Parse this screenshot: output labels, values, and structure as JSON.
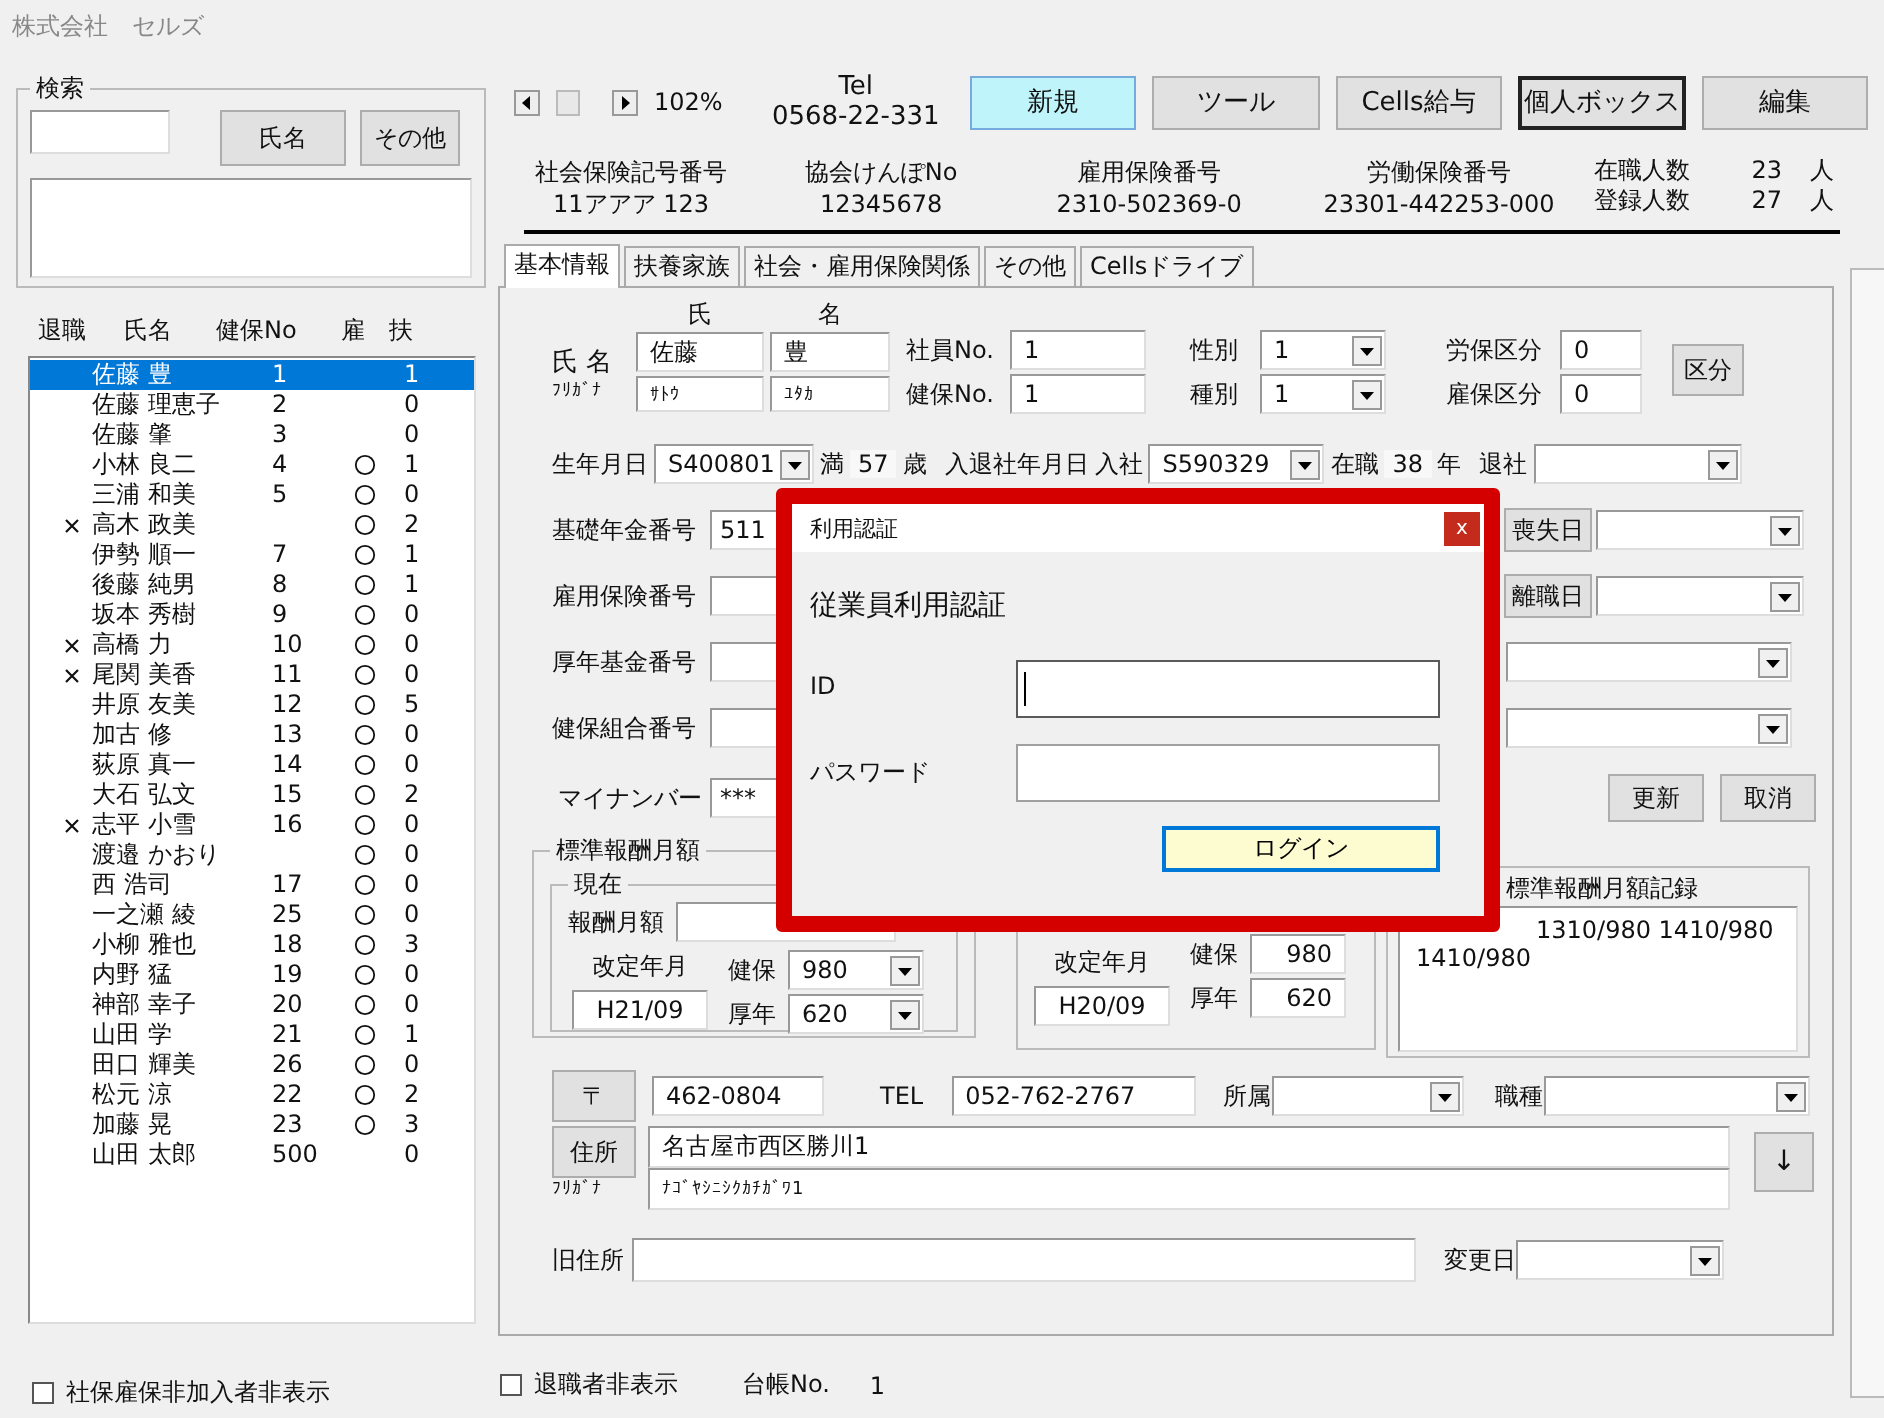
{
  "app_title": "株式会社　セルズ",
  "search": {
    "title": "検索",
    "buttons": [
      "氏名",
      "その他"
    ]
  },
  "employee_list": {
    "columns": [
      "退職",
      "氏名",
      "健保No",
      "雇",
      "扶"
    ],
    "rows": [
      {
        "retired": false,
        "name": "佐藤 豊",
        "kenpo_no": "1",
        "insured": false,
        "dependents": "1",
        "selected": true
      },
      {
        "retired": false,
        "name": "佐藤 理恵子",
        "kenpo_no": "2",
        "insured": false,
        "dependents": "0",
        "selected": false
      },
      {
        "retired": false,
        "name": "佐藤 肇",
        "kenpo_no": "3",
        "insured": false,
        "dependents": "0",
        "selected": false
      },
      {
        "retired": false,
        "name": "小林 良二",
        "kenpo_no": "4",
        "insured": true,
        "dependents": "1",
        "selected": false
      },
      {
        "retired": false,
        "name": "三浦 和美",
        "kenpo_no": "5",
        "insured": true,
        "dependents": "0",
        "selected": false
      },
      {
        "retired": true,
        "name": "高木 政美",
        "insured": true,
        "dependents": "2",
        "selected": false
      },
      {
        "retired": false,
        "name": "伊勢 順一",
        "kenpo_no": "7",
        "insured": true,
        "dependents": "1",
        "selected": false
      },
      {
        "retired": false,
        "name": "後藤 純男",
        "kenpo_no": "8",
        "insured": true,
        "dependents": "1",
        "selected": false
      },
      {
        "retired": false,
        "name": "坂本 秀樹",
        "kenpo_no": "9",
        "insured": true,
        "dependents": "0",
        "selected": false
      },
      {
        "retired": true,
        "name": "高橋 力",
        "kenpo_no": "10",
        "insured": true,
        "dependents": "0",
        "selected": false
      },
      {
        "retired": true,
        "name": "尾関 美香",
        "kenpo_no": "11",
        "insured": true,
        "dependents": "0",
        "selected": false
      },
      {
        "retired": false,
        "name": "井原 友美",
        "kenpo_no": "12",
        "insured": true,
        "dependents": "5",
        "selected": false
      },
      {
        "retired": false,
        "name": "加古 修",
        "kenpo_no": "13",
        "insured": true,
        "dependents": "0",
        "selected": false
      },
      {
        "retired": false,
        "name": "荻原 真一",
        "kenpo_no": "14",
        "insured": true,
        "dependents": "0",
        "selected": false
      },
      {
        "retired": false,
        "name": "大石 弘文",
        "kenpo_no": "15",
        "insured": true,
        "dependents": "2",
        "selected": false
      },
      {
        "retired": true,
        "name": "志平 小雪",
        "kenpo_no": "16",
        "insured": true,
        "dependents": "0",
        "selected": false
      },
      {
        "retired": false,
        "name": "渡邉 かおり",
        "insured": true,
        "dependents": "0",
        "selected": false
      },
      {
        "retired": false,
        "name": "西 浩司",
        "kenpo_no": "17",
        "insured": true,
        "dependents": "0",
        "selected": false
      },
      {
        "retired": false,
        "name": "一之瀬 綾",
        "kenpo_no": "25",
        "insured": true,
        "dependents": "0",
        "selected": false
      },
      {
        "retired": false,
        "name": "小柳 雅也",
        "kenpo_no": "18",
        "insured": true,
        "dependents": "3",
        "selected": false
      },
      {
        "retired": false,
        "name": "内野 猛",
        "kenpo_no": "19",
        "insured": true,
        "dependents": "0",
        "selected": false
      },
      {
        "retired": false,
        "name": "神部 幸子",
        "kenpo_no": "20",
        "insured": true,
        "dependents": "0",
        "selected": false
      },
      {
        "retired": false,
        "name": "山田 学",
        "kenpo_no": "21",
        "insured": true,
        "dependents": "1",
        "selected": false
      },
      {
        "retired": false,
        "name": "田口 輝美",
        "kenpo_no": "26",
        "insured": true,
        "dependents": "0",
        "selected": false
      },
      {
        "retired": false,
        "name": "松元 涼",
        "kenpo_no": "22",
        "insured": true,
        "dependents": "2",
        "selected": false
      },
      {
        "retired": false,
        "name": "加藤 晃",
        "kenpo_no": "23",
        "insured": true,
        "dependents": "3",
        "selected": false
      },
      {
        "retired": false,
        "name": "山田 太郎",
        "kenpo_no": "500",
        "insured": false,
        "dependents": "0",
        "selected": false
      }
    ]
  },
  "hide_uninsured": {
    "label": "社保雇保非加入者非表示",
    "checked": false
  },
  "zoom": {
    "value": "102%"
  },
  "tel": {
    "label": "Tel",
    "value": "0568-22-331"
  },
  "toolbar": [
    {
      "label": "新規",
      "highlighted": true,
      "focused": false
    },
    {
      "label": "ツール",
      "highlighted": false,
      "focused": false
    },
    {
      "label": "Cells給与",
      "highlighted": false,
      "focused": false
    },
    {
      "label": "個人ボックス",
      "highlighted": false,
      "focused": true
    },
    {
      "label": "編集",
      "highlighted": false,
      "focused": false
    }
  ],
  "insurance_numbers": [
    {
      "label": "社会保険記号番号",
      "value": "11アアア 123"
    },
    {
      "label": "協会けんぽNo",
      "value": "12345678"
    },
    {
      "label": "雇用保険番号",
      "value": "2310-502369-0"
    },
    {
      "label": "労働保険番号",
      "value": "23301-442253-000"
    }
  ],
  "headcounts": [
    {
      "label": "在職人数",
      "value": "23",
      "unit": "人"
    },
    {
      "label": "登録人数",
      "value": "27",
      "unit": "人"
    }
  ],
  "tabs": [
    {
      "label": "基本情報",
      "selected": true
    },
    {
      "label": "扶養家族",
      "selected": false
    },
    {
      "label": "社会・雇用保険関係",
      "selected": false
    },
    {
      "label": "その他",
      "selected": false
    },
    {
      "label": "Cellsドライブ",
      "selected": false
    }
  ],
  "basic_info": {
    "name_label": "氏 名",
    "furigana_label": "ﾌﾘｶﾞﾅ",
    "family_header": "氏",
    "given_header": "名",
    "family_name": "佐藤",
    "given_name": "豊",
    "family_kana": "ｻﾄｳ",
    "given_kana": "ﾕﾀｶ",
    "employee_no": {
      "label": "社員No.",
      "value": "1"
    },
    "kenpo_no": {
      "label": "健保No.",
      "value": "1"
    },
    "gender": {
      "label": "性別",
      "value": "1"
    },
    "category": {
      "label": "種別",
      "value": "1"
    },
    "rouho": {
      "label": "労保区分",
      "value": "0"
    },
    "koho": {
      "label": "雇保区分",
      "value": "0"
    },
    "kubun_button": "区分",
    "birth": {
      "label": "生年月日",
      "value": "S400801"
    },
    "age": {
      "prefix": "満",
      "value": "57",
      "unit": "歳"
    },
    "employment_label": "入退社年月日",
    "hire": {
      "label": "入社",
      "value": "S590329"
    },
    "tenure": {
      "prefix": "在職",
      "value": "38",
      "unit": "年"
    },
    "leave": {
      "label": "退社"
    },
    "number_rows": [
      {
        "label": "基礎年金番号",
        "value": "511",
        "button": "喪失日"
      },
      {
        "label": "雇用保険番号",
        "button": "離職日"
      },
      {
        "label": "厚年基金番号"
      },
      {
        "label": "健保組合番号"
      }
    ],
    "my_number": {
      "label": "マイナンバー",
      "value": "***"
    },
    "update_button": "更新",
    "cancel_button": "取消",
    "standard_pay": {
      "title": "標準報酬月額",
      "current": {
        "title": "現在",
        "pay_label": "報酬月額",
        "revision_label": "改定年月",
        "revision": "H21/09",
        "kenpo_label": "健保",
        "kenpo": "980",
        "kounen_label": "厚年",
        "kounen": "620"
      },
      "previous": {
        "revision_label": "改定年月",
        "revision": "H20/09",
        "kenpo_label": "健保",
        "kenpo": "980",
        "kounen_label": "厚年",
        "kounen": "620"
      },
      "history": {
        "title": "標準報酬月額記録",
        "lines": [
          "1310/980 1410/980",
          "1410/980"
        ]
      }
    },
    "postal": {
      "button": "〒",
      "value": "462-0804"
    },
    "phone": {
      "label": "TEL",
      "value": "052-762-2767"
    },
    "department": {
      "label": "所属"
    },
    "job_type": {
      "label": "職種"
    },
    "address": {
      "button": "住所",
      "value": "名古屋市西区勝川1",
      "kana_label": "ﾌﾘｶﾞﾅ",
      "kana": "ﾅｺﾞﾔｼﾆｼｸｶﾁｶﾞﾜ1",
      "down_button": "↓"
    },
    "old_address": {
      "label": "旧住所"
    },
    "change_date": {
      "label": "変更日"
    }
  },
  "hide_retired": {
    "label": "退職者非表示",
    "checked": false
  },
  "ledger": {
    "label": "台帳No.",
    "value": "1"
  },
  "dialog": {
    "title": "利用認証",
    "close": "x",
    "heading": "従業員利用認証",
    "fields": [
      {
        "label": "ID",
        "focused": true
      },
      {
        "label": "パスワード",
        "focused": false
      }
    ],
    "button": "ログイン"
  }
}
